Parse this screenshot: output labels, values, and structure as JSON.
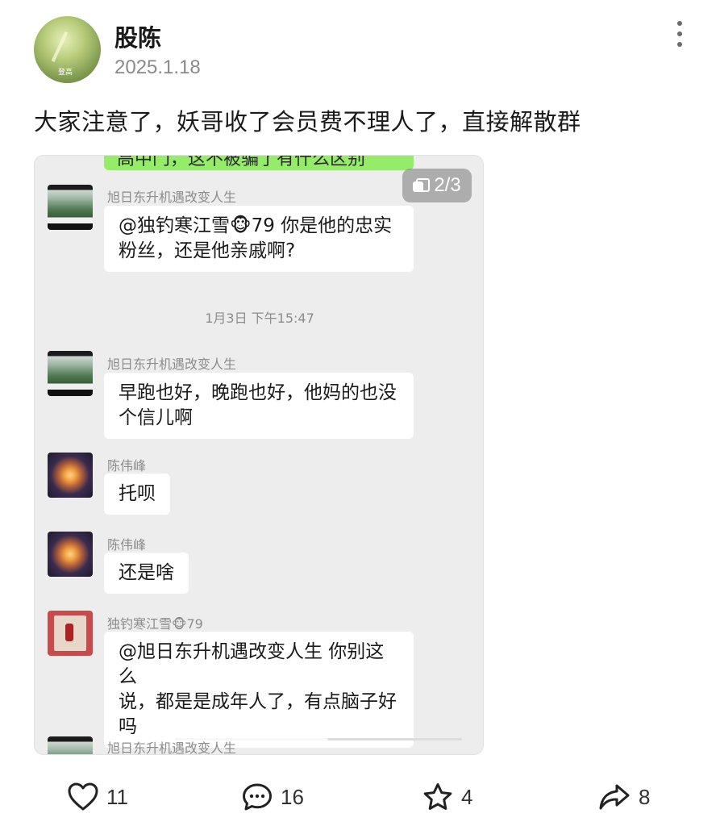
{
  "post": {
    "author": "股陈",
    "date": "2025.1.18",
    "avatar_caption": "登高",
    "text": "大家注意了，妖哥收了会员费不理人了，直接解散群"
  },
  "image": {
    "page_indicator": "2/3",
    "top_bubble_partial": "高中门，这不被骗了有什么区别",
    "messages": [
      {
        "sender": "旭日东升机遇改变人生",
        "lines": [
          "@独钓寒江雪🐵79 你是他的忠实",
          "粉丝，还是他亲戚啊?"
        ]
      },
      {
        "timestamp": "1月3日 下午15:47"
      },
      {
        "sender": "旭日东升机遇改变人生",
        "lines": [
          "早跑也好，晚跑也好，他妈的也没",
          "个信儿啊"
        ]
      },
      {
        "sender": "陈伟峰",
        "lines": [
          "托呗"
        ]
      },
      {
        "sender": "陈伟峰",
        "lines": [
          "还是啥"
        ]
      },
      {
        "sender": "独钓寒江雪🐵79",
        "lines": [
          "@旭日东升机遇改变人生 你别这么",
          "说，都是是成年人了，有点脑子好",
          "吗"
        ]
      },
      {
        "sender": "旭日东升机遇改变人生"
      }
    ]
  },
  "actions": {
    "like_count": "11",
    "comment_count": "16",
    "favorite_count": "4",
    "share_count": "8"
  }
}
